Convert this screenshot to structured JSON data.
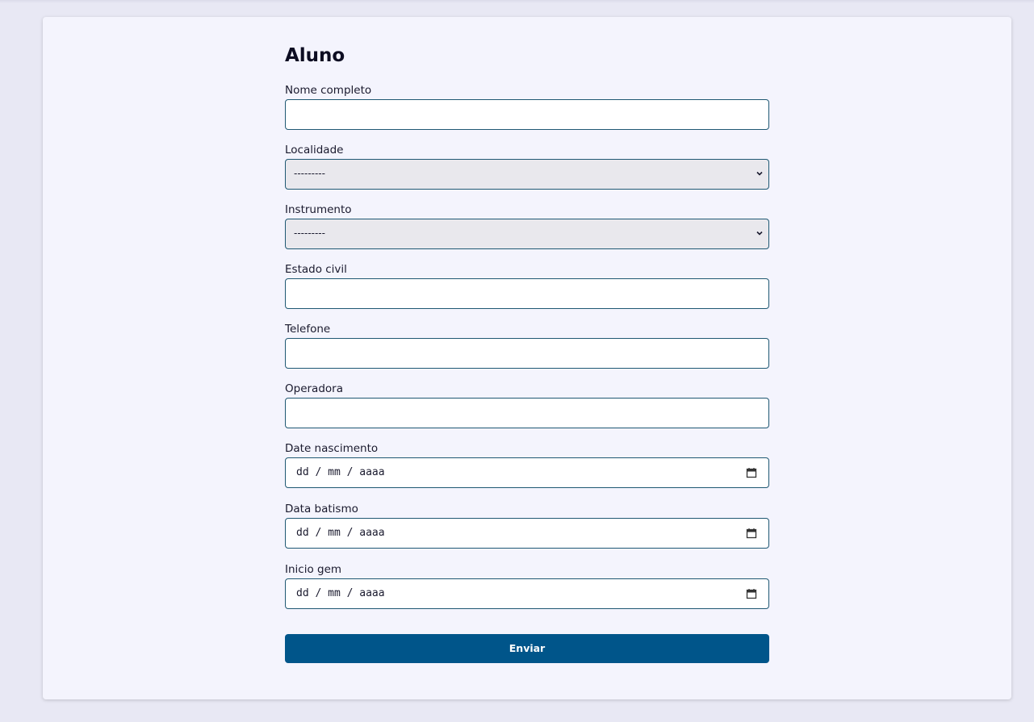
{
  "form": {
    "title": "Aluno",
    "fields": {
      "nome_completo": {
        "label": "Nome completo",
        "value": ""
      },
      "localidade": {
        "label": "Localidade",
        "selected": "---------"
      },
      "instrumento": {
        "label": "Instrumento",
        "selected": "---------"
      },
      "estado_civil": {
        "label": "Estado civil",
        "value": ""
      },
      "telefone": {
        "label": "Telefone",
        "value": ""
      },
      "operadora": {
        "label": "Operadora",
        "value": ""
      },
      "date_nascimento": {
        "label": "Date nascimento",
        "value": "dd / mm / aaaa"
      },
      "data_batismo": {
        "label": "Data batismo",
        "value": "dd / mm / aaaa"
      },
      "inicio_gem": {
        "label": "Inicio gem",
        "value": "dd / mm / aaaa"
      }
    },
    "submit_label": "Enviar"
  },
  "icons": {
    "select_arrow": "chevron-down-icon",
    "date_picker": "calendar-icon"
  },
  "colors": {
    "page_background": "#e8e8f4",
    "card_background": "#f4f4fd",
    "field_border": "#1f5873",
    "select_background": "#e9e8ed",
    "button_background": "#00558a",
    "button_text": "#ffffff"
  }
}
